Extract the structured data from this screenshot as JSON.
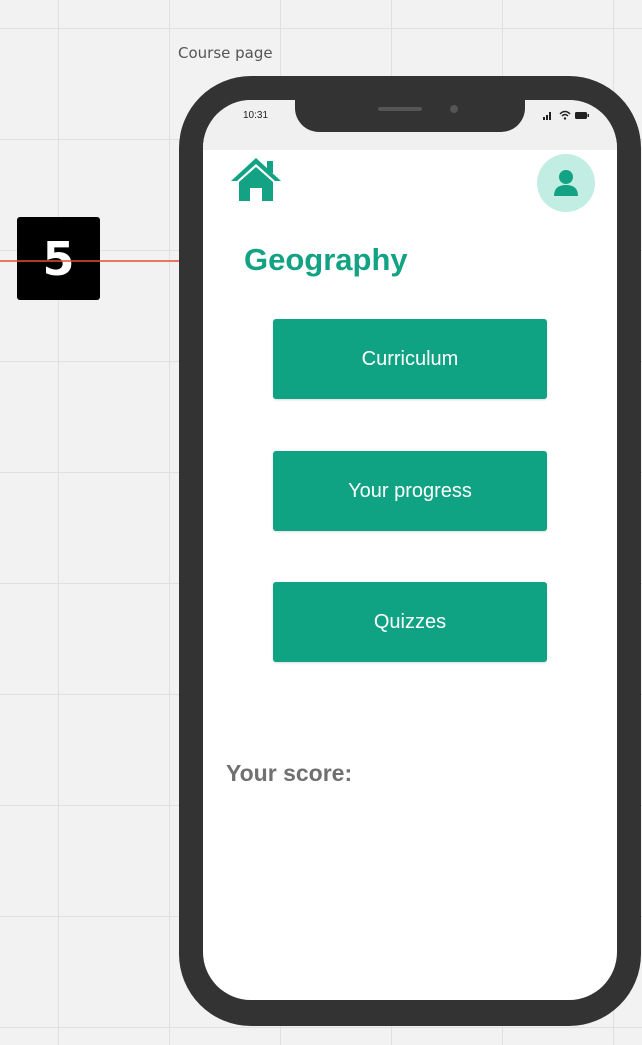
{
  "canvas": {
    "frame_label": "Course page",
    "step_number": "5",
    "annotation_color": "#e8502f"
  },
  "status_bar": {
    "time": "10:31",
    "icons": [
      "signal-icon",
      "wifi-icon",
      "battery-icon"
    ]
  },
  "header": {
    "home_icon": "home-icon",
    "profile_icon": "user-icon"
  },
  "course": {
    "title": "Geography"
  },
  "menu": {
    "buttons": [
      {
        "label": "Curriculum"
      },
      {
        "label": "Your progress"
      },
      {
        "label": "Quizzes"
      }
    ]
  },
  "score": {
    "label": "Your score:"
  },
  "colors": {
    "brand": "#10a383",
    "brand_light": "#c2ede2",
    "phone_frame": "#333333",
    "score_text": "#707070"
  }
}
